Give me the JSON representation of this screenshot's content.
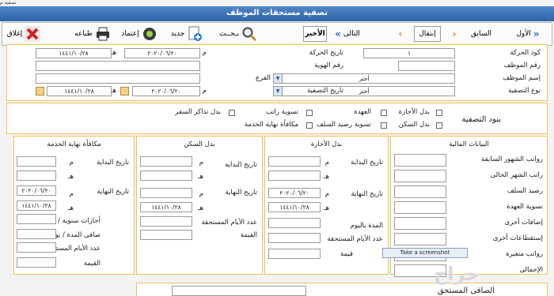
{
  "window_corner_text": "تصفية م",
  "title": "تصفية مستحقات الموظف",
  "toolbar": {
    "close": "إغلاق",
    "print": "طباعه",
    "approve": "إعتماد",
    "new": "جديد",
    "search": "بـحــث",
    "last": "الأخير",
    "next": "التالى",
    "move": "إنتقال",
    "prev": "السابق",
    "first": "الأول"
  },
  "header": {
    "movement_code_label": "كود الحركة",
    "movement_code_value": "١",
    "movement_date_label": "تاريخ الحركة",
    "greg_suffix": "م",
    "hijri_suffix": "هـ",
    "movement_date_greg": "٢٠٢٠/٠٦/٢٠",
    "movement_date_hijri": "١٤٤١/١٠/٢٨",
    "employee_no_label": "رقم الموظف",
    "id_no_label": "رقم الهوية",
    "employee_name_label": "إسم الموظف",
    "branch_label": "الفرع",
    "branch_value": "أختر",
    "employee_name_value": "أختر",
    "settlement_type_label": "نوع التصفية",
    "settlement_type_value": "أختر",
    "settlement_date_label": "تاريخ التصفية",
    "settlement_date_greg": "٢٠٢٠/٠٦/٢٠",
    "settlement_date_hijri": "١٤٤١/١٠/٢٨"
  },
  "items": {
    "title": "بنود التصفية",
    "checkboxes": [
      "بدل الأجازة",
      "العهدة",
      "تسوية راتب",
      "بدل تذاكر السفر",
      "بدل السكن",
      "تسوية رصيد السلف",
      "مكافأة نهاية الخدمة"
    ]
  },
  "financial": {
    "title": "البيانات المالية",
    "rows": [
      "رواتب الشهور السابقة",
      "راتب الشهر الحالى",
      "رصيد السلف",
      "تسوية العهدة",
      "إضافات أخرى",
      "إستقطاعات أخرى",
      "رواتب متغيرة",
      "الإجمالى"
    ]
  },
  "vacation": {
    "title": "بدل الأجازة",
    "start": "تاريخ البداية",
    "end": "تاريخ النهاية",
    "greg": "م",
    "hijri": "هـ",
    "end_greg": "٢٠٢٠/٠٦/٢٠",
    "end_hijri": "١٤٤١/١٠/٢٨",
    "days": "المدة باليوم",
    "due_days": "عدد الأيام المستحقة",
    "value": "قيمة"
  },
  "housing": {
    "title": "بدل السكن",
    "start": "تاريخ البداية",
    "end": "تاريخ النهاية",
    "greg": "م",
    "hijri": "هـ",
    "end_hijri": "١٤٤١/١٠/٢٨",
    "due_days": "عدد الأيام المستحقة",
    "value": "القيمة"
  },
  "eos": {
    "title": "مكافأة نهاية الخدمة",
    "start": "تاريخ البداية",
    "end": "تاريخ النهاية",
    "greg": "م",
    "hijri": "هـ",
    "end_greg": "٢٠٢٠/٠٦/٢٠",
    "end_hijri": "١٤٤١/١٠/٢٨",
    "annual_leave": "أجازات سنوية / يوم",
    "net_period": "صافى المدة / يوم",
    "due_days": "عدد الأيام المستحقة",
    "value": "القيمة"
  },
  "net_due_label": "الصافى المستحق",
  "tooltip": "Take a screenshot",
  "watermark": "حراج",
  "colors": {
    "accent": "#2f65a8",
    "border": "#f0c15a"
  }
}
